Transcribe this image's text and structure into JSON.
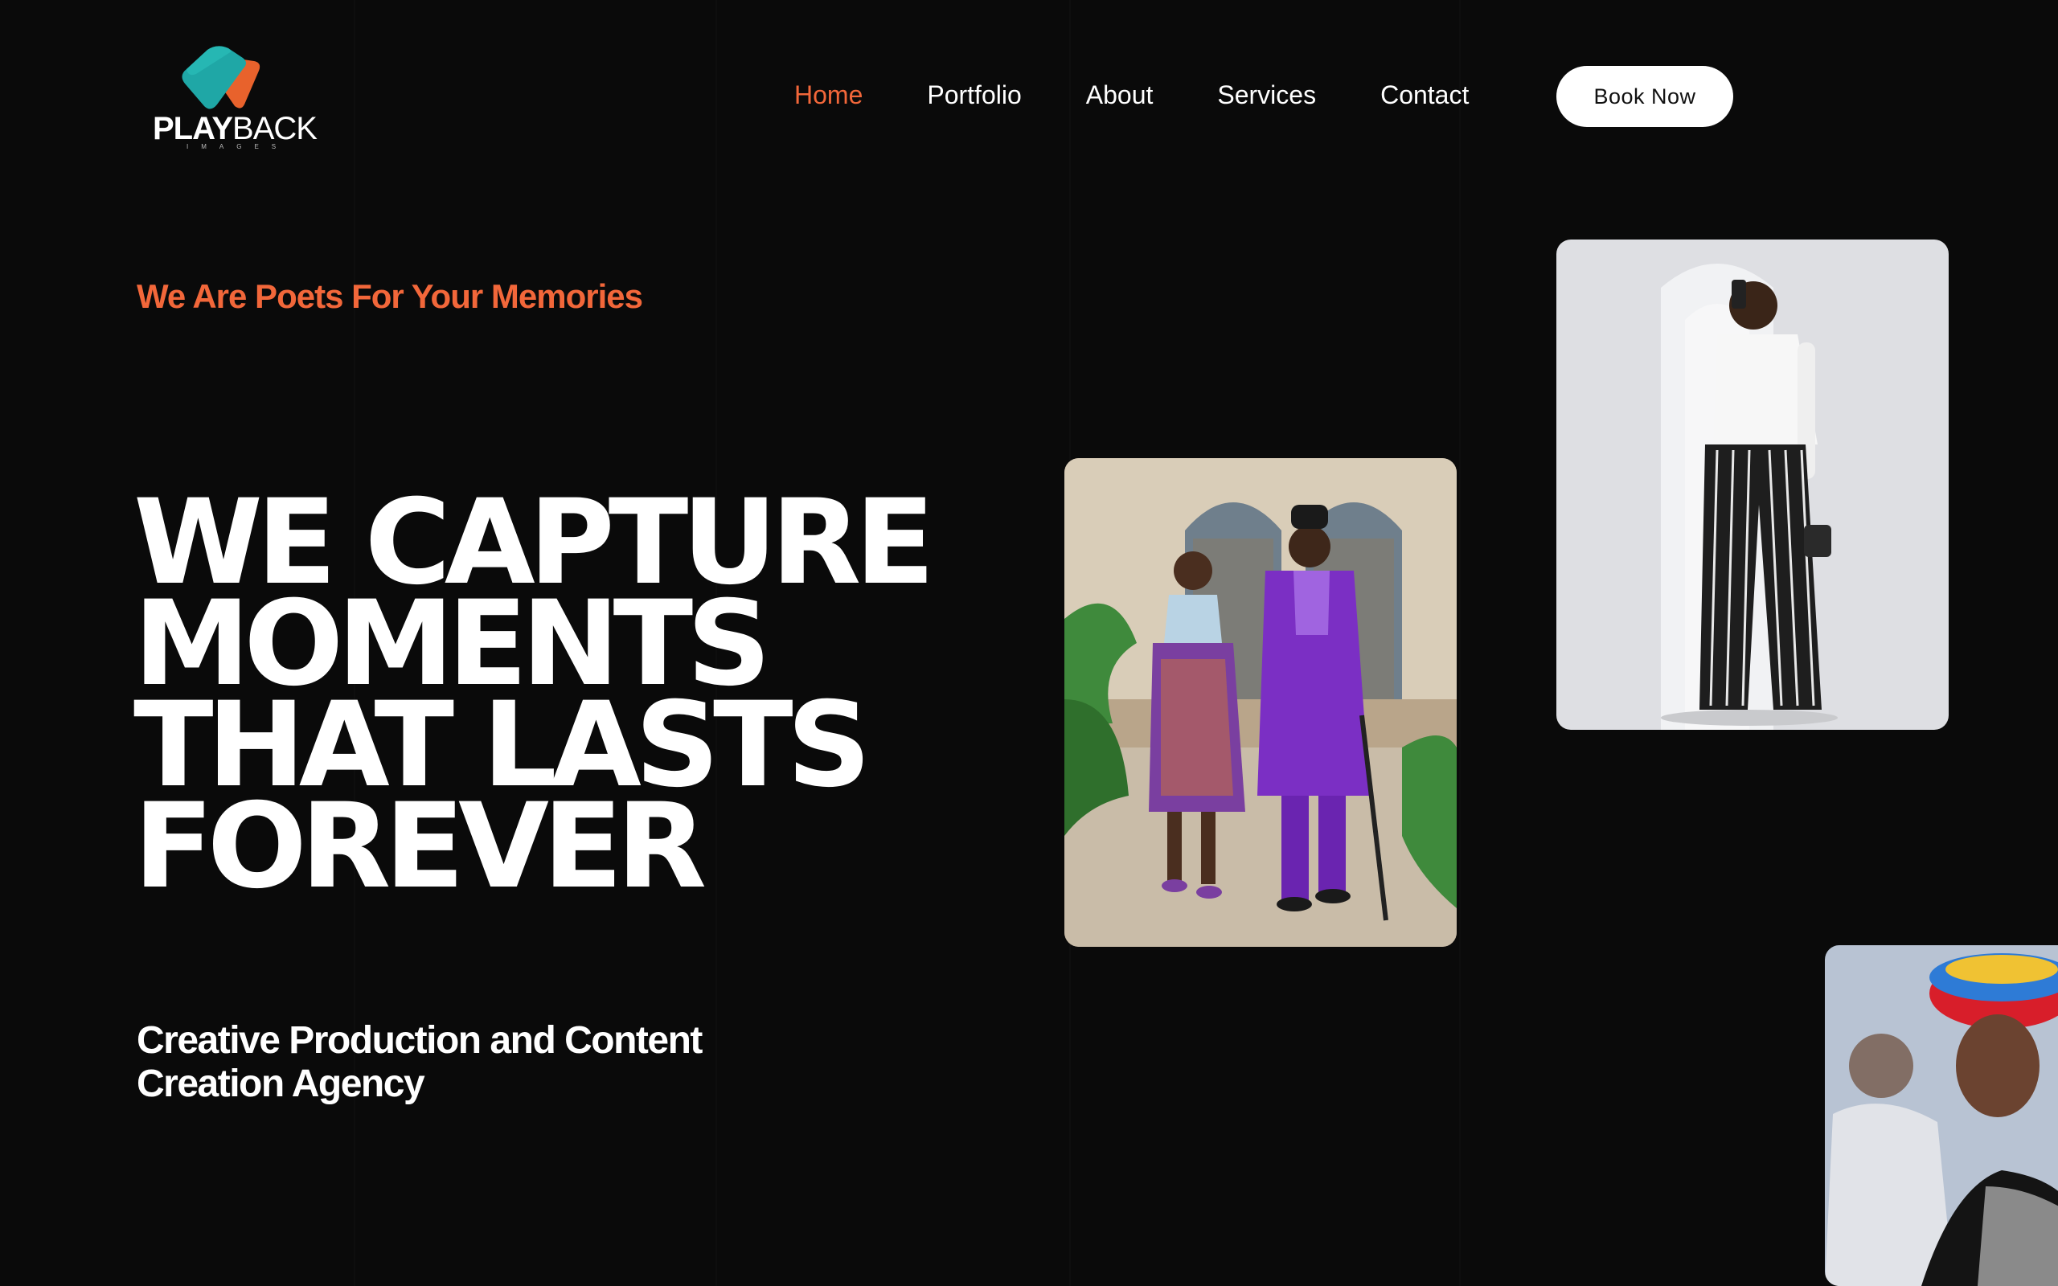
{
  "brand": {
    "name_bold": "PLAY",
    "name_thin": "BACK",
    "subtitle": "IMAGES",
    "colors": {
      "teal": "#1fa7a6",
      "orange": "#e8622c"
    }
  },
  "nav": {
    "items": [
      {
        "label": "Home",
        "active": true
      },
      {
        "label": "Portfolio",
        "active": false
      },
      {
        "label": "About",
        "active": false
      },
      {
        "label": "Services",
        "active": false
      },
      {
        "label": "Contact",
        "active": false
      }
    ],
    "cta_label": "Book Now"
  },
  "hero": {
    "tagline": "We Are Poets For Your Memories",
    "headline_lines": [
      "WE CAPTURE",
      "MOMENTS",
      "THAT LASTS",
      "FOREVER"
    ],
    "subhead_lines": [
      "Creative Production and Content",
      "Creation Agency"
    ]
  },
  "theme": {
    "background": "#0a0a0a",
    "accent": "#f2673a",
    "text": "#ffffff"
  }
}
